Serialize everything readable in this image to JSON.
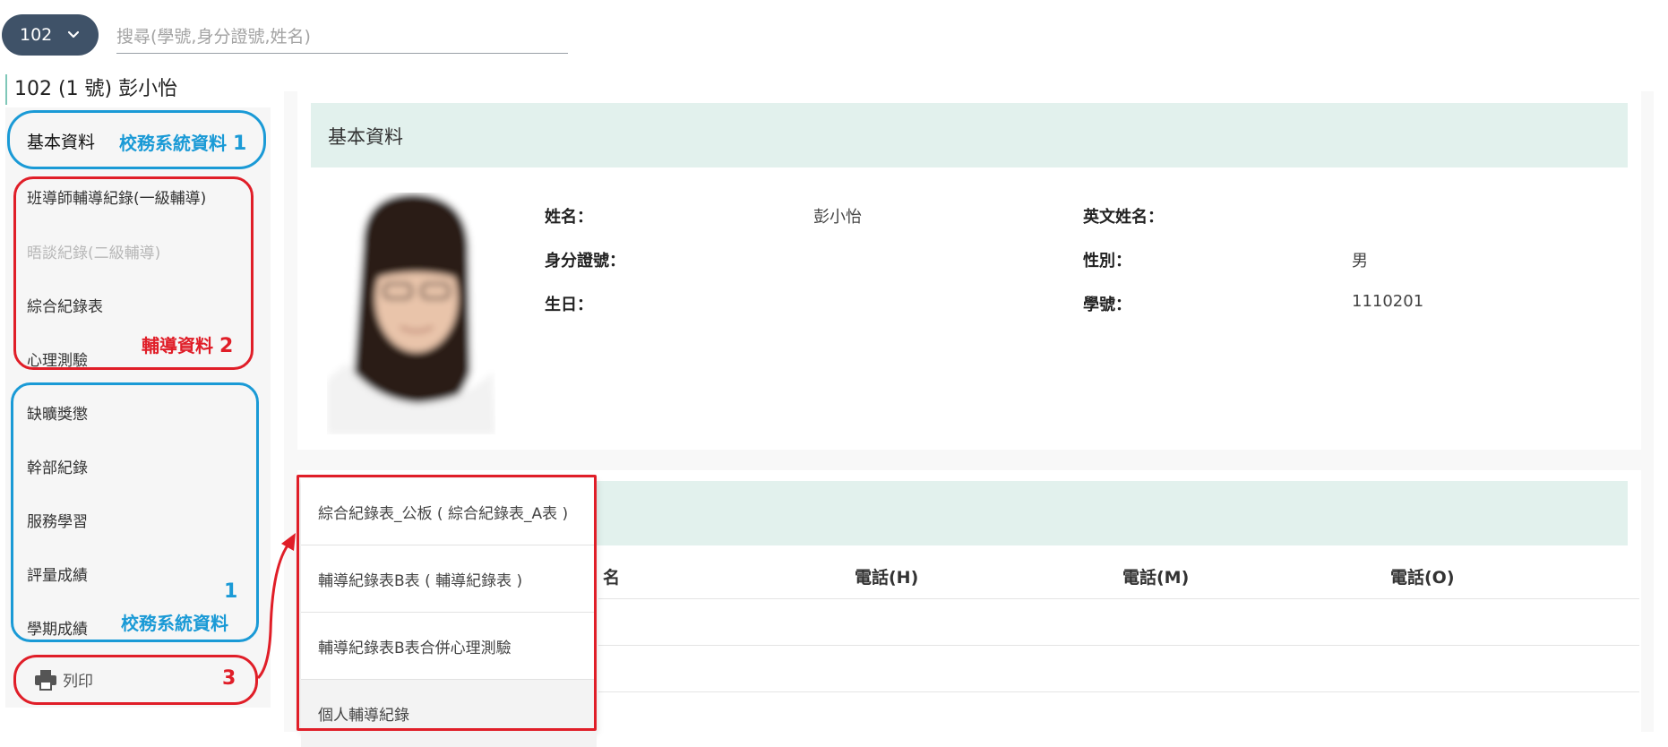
{
  "top": {
    "class_select": "102",
    "search_placeholder": "搜尋(學號,身分證號,姓名)"
  },
  "student_title": "102 (1 號) 彭小怡",
  "sidebar": {
    "items": [
      {
        "label": "基本資料"
      },
      {
        "label": "班導師輔導紀錄(一級輔導)"
      },
      {
        "label": "晤談紀錄(二級輔導)"
      },
      {
        "label": "綜合紀錄表"
      },
      {
        "label": "心理測驗"
      },
      {
        "label": "缺曠獎懲"
      },
      {
        "label": "幹部紀錄"
      },
      {
        "label": "服務學習"
      },
      {
        "label": "評量成績"
      },
      {
        "label": "學期成績"
      }
    ],
    "print_label": "列印"
  },
  "annotations": {
    "a1_text": "校務系統資料",
    "a1_num": "1",
    "a2_text": "輔導資料",
    "a2_num": "2",
    "a3_num": "1",
    "a3_text": "校務系統資料",
    "a4_num": "3",
    "colors": {
      "blue": "#1a9ad6",
      "red": "#e01e28"
    }
  },
  "basic_info": {
    "header": "基本資料",
    "fields": {
      "name_label": "姓名：",
      "name_value": "彭小怡",
      "en_name_label": "英文姓名：",
      "en_name_value": "",
      "id_label": "身分證號：",
      "id_value": "",
      "gender_label": "性別：",
      "gender_value": "男",
      "birthday_label": "生日：",
      "birthday_value": "",
      "student_no_label": "學號：",
      "student_no_value": "1110201"
    }
  },
  "guardian_table": {
    "headers": [
      "名",
      "電話(H)",
      "電話(M)",
      "電話(O)"
    ]
  },
  "print_menu": {
    "items": [
      {
        "label": "綜合紀錄表_公板 ( 綜合紀錄表_A表 )"
      },
      {
        "label": "輔導紀錄表B表 ( 輔導紀錄表 )"
      },
      {
        "label": "輔導紀錄表B表合併心理測驗"
      },
      {
        "label": "個人輔導紀錄"
      }
    ]
  },
  "colors": {
    "header_bg": "#e2f1ed",
    "select_bg": "#3f5268",
    "accent_teal": "#7fc7b8"
  }
}
